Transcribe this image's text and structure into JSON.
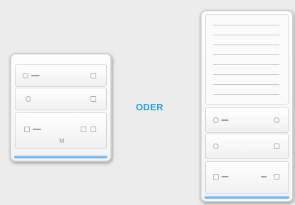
{
  "separator_label": "ODER",
  "panel_label": "M",
  "colors": {
    "accent": "#1ea2de",
    "led": "#5aa8f0",
    "background": "#ececec"
  }
}
